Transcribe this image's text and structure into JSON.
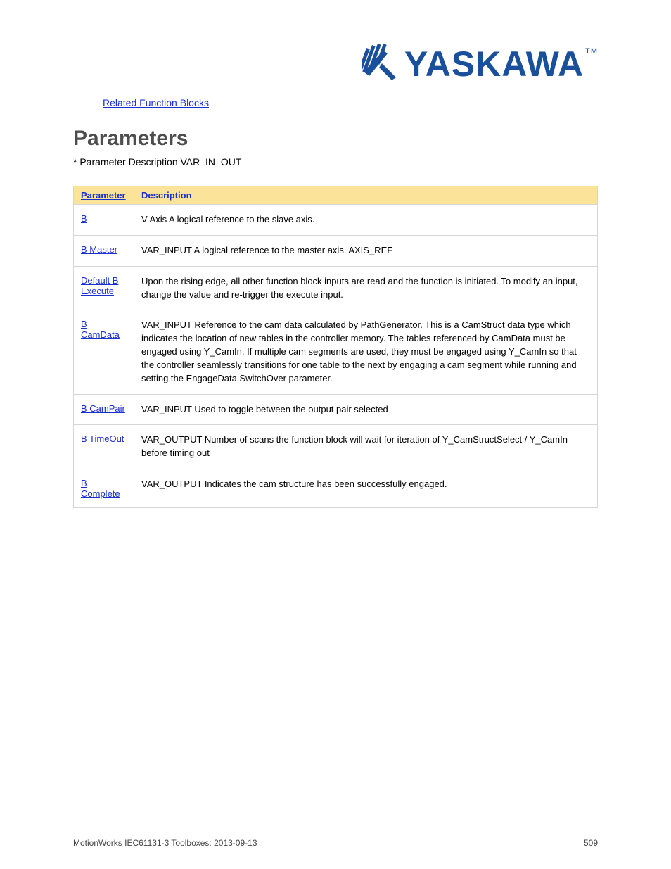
{
  "logo": {
    "text": "YASKAWA",
    "tm": "TM"
  },
  "related_label": "Related Function Blocks",
  "section": {
    "title": "Parameters",
    "desc": "* Parameter Description   VAR_IN_OUT"
  },
  "table": {
    "headers": {
      "param": "Parameter",
      "desc": "Description"
    },
    "rows": [
      {
        "param": "B",
        "desc": "V   Axis   A logical reference to the slave axis."
      },
      {
        "param": "B   Master",
        "desc": "VAR_INPUT  A logical reference to the master axis.  AXIS_REF"
      },
      {
        "param": "Default   B   Execute",
        "desc": "Upon the rising edge, all other function block inputs are read and the function is initiated. To modify an input, change the value and re-trigger the execute input."
      },
      {
        "param": "B   CamData",
        "desc": "VAR_INPUT  Reference to the cam data calculated by PathGenerator. This is a CamStruct data type which indicates the location of new tables in the controller memory. The tables referenced by CamData must be engaged using Y_CamIn. If multiple cam segments are used, they must be engaged using Y_CamIn so that the controller seamlessly transitions for one table to the next by engaging a cam segment while running and setting the EngageData.SwitchOver parameter."
      },
      {
        "param": "B   CamPair",
        "desc": "VAR_INPUT  Used to toggle between the output pair selected"
      },
      {
        "param": "B   TimeOut",
        "desc": "VAR_OUTPUT  Number of scans the function block will wait for iteration of Y_CamStructSelect / Y_CamIn before timing out"
      },
      {
        "param": "B   Complete",
        "desc": "VAR_OUTPUT  Indicates the cam structure has been successfully engaged."
      }
    ]
  },
  "footer": {
    "left": "MotionWorks IEC61131-3 Toolboxes: 2013-09-13",
    "right": "509"
  }
}
